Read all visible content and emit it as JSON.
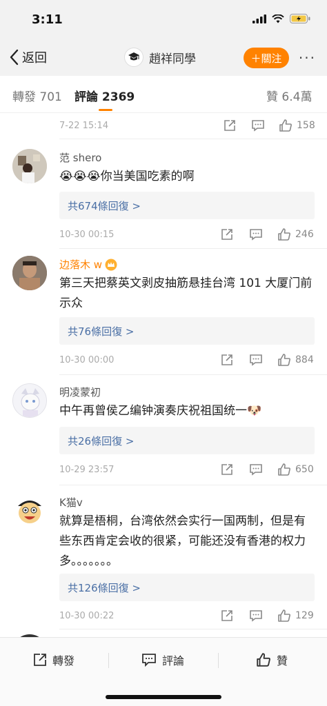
{
  "status": {
    "time": "3:11"
  },
  "nav": {
    "back_label": "返回",
    "account_name": "趙祥同學",
    "follow_label": "＋關注",
    "more_label": "···"
  },
  "tabs": {
    "reposts": "轉發 701",
    "comments": "評論 2369",
    "likes": "贊 6.4萬"
  },
  "top_action": {
    "time": "7-22 15:14",
    "likes": "158"
  },
  "comments": [
    {
      "name": "范 shero",
      "text": "😭😭😭你当美国吃素的啊",
      "replies": "共674條回復 >",
      "time": "10-30 00:15",
      "likes": "246"
    },
    {
      "name": "边落木 w",
      "text": "第三天把蔡英文剥皮抽筋悬挂台湾 101 大厦门前示众",
      "replies": "共76條回復 >",
      "time": "10-30 00:00",
      "likes": "884"
    },
    {
      "name": "明凌蒙初",
      "text": "中午再曾侯乙编钟演奏庆祝祖国统一🐶",
      "replies": "共26條回復 >",
      "time": "10-29 23:57",
      "likes": "650"
    },
    {
      "name": "K猫v",
      "text": "就算是梧桐，台湾依然会实行一国两制，但是有些东西肯定会收的很紧，可能还没有香港的权力多。。。。。。。",
      "replies": "共126條回復 >",
      "time": "10-30 00:22",
      "likes": "129"
    }
  ],
  "bottom_bar": {
    "repost": "轉發",
    "comment": "評論",
    "like": "贊"
  },
  "colors": {
    "accent": "#ff8200",
    "link": "#4a6fa5",
    "vip_name": "#ff8200"
  },
  "icons": [
    "back-chevron-icon",
    "signal-icon",
    "wifi-icon",
    "battery-icon",
    "share-icon",
    "comment-icon",
    "thumbs-up-icon",
    "crown-badge-icon"
  ]
}
